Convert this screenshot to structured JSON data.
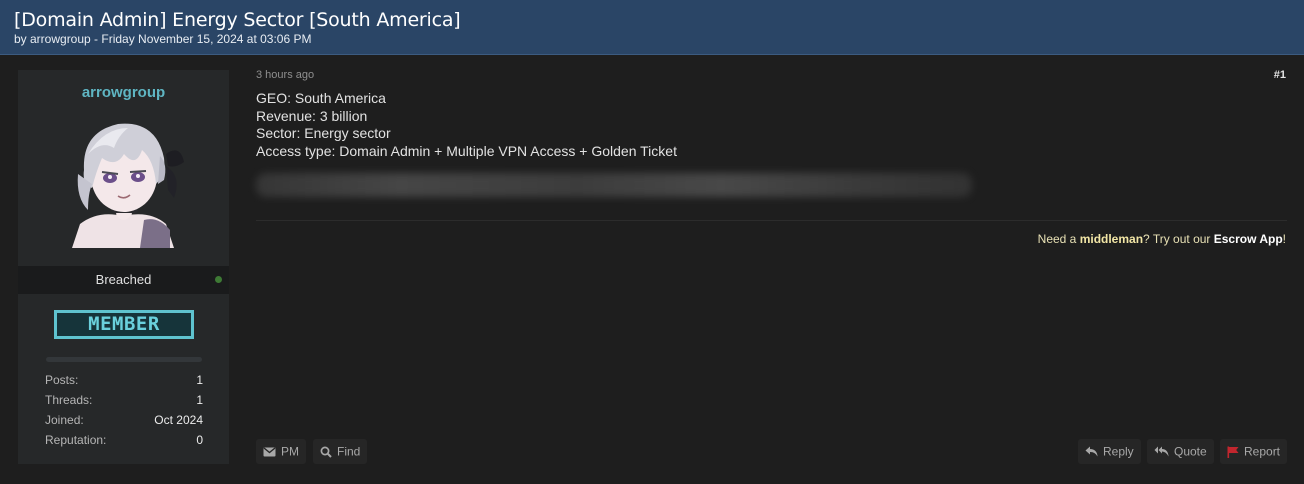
{
  "thread": {
    "title": "[Domain Admin] Energy Sector [South America]",
    "byline": "by arrowgroup - Friday November 15, 2024 at 03:06 PM"
  },
  "author": {
    "username": "arrowgroup",
    "usergroup": "Breached",
    "rank": "MEMBER",
    "stats": [
      {
        "label": "Posts:",
        "value": "1"
      },
      {
        "label": "Threads:",
        "value": "1"
      },
      {
        "label": "Joined:",
        "value": "Oct 2024"
      },
      {
        "label": "Reputation:",
        "value": "0"
      }
    ]
  },
  "post": {
    "time_ago": "3 hours ago",
    "number": "#1",
    "lines": [
      "GEO: South America",
      "Revenue: 3 billion",
      "Sector: Energy sector",
      "Access type: Domain Admin + Multiple VPN Access + Golden Ticket"
    ]
  },
  "signature": {
    "prefix": "Need a ",
    "highlight": "middleman",
    "middle": "? Try out our ",
    "link": "Escrow App",
    "suffix": "!"
  },
  "actions": {
    "pm": "PM",
    "find": "Find",
    "reply": "Reply",
    "quote": "Quote",
    "report": "Report"
  },
  "colors": {
    "header_bg": "#2a4566",
    "username": "#5fb6c3",
    "rank_badge": "#5fc3cf",
    "online_dot": "#3e7a35",
    "report_flag": "#c2262e"
  },
  "icons": [
    "envelope-icon",
    "search-icon",
    "reply-icon",
    "quote-icon",
    "flag-icon"
  ]
}
